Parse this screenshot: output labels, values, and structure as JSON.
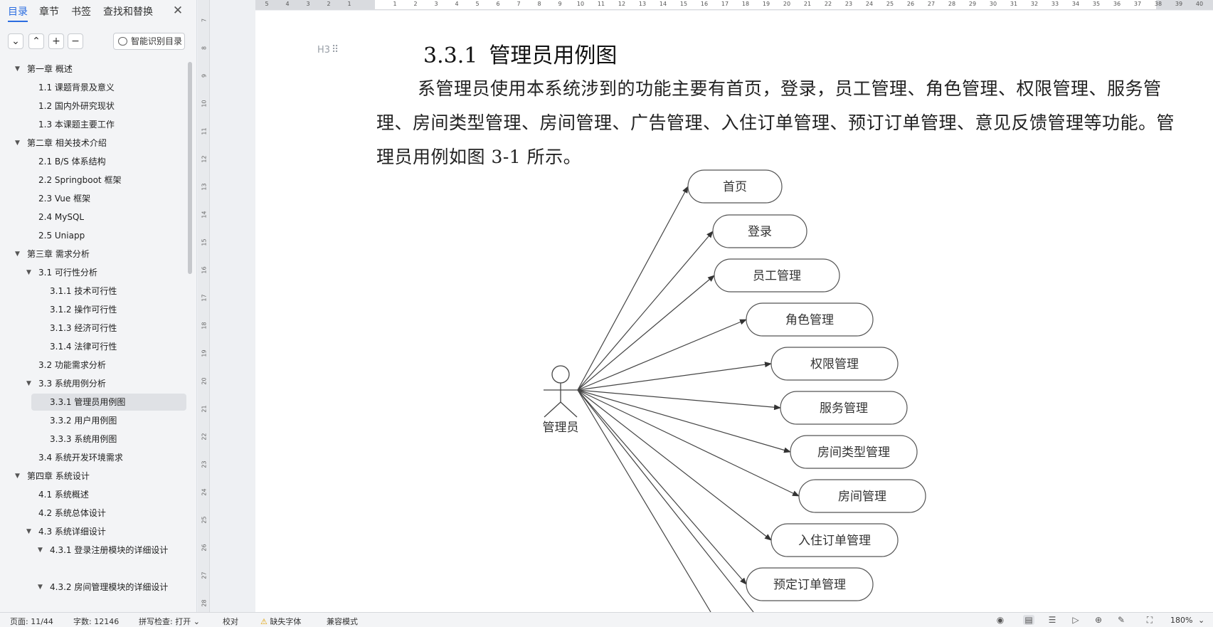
{
  "nav": {
    "tabs": [
      "目录",
      "章节",
      "书签",
      "查找和替换"
    ],
    "close_glyph": "✕",
    "toolbar": {
      "collapse_glyph": "⌄",
      "expand_glyph": "⌃",
      "add_glyph": "+",
      "remove_glyph": "−",
      "smart_toc_label": "智能识别目录"
    },
    "toc": [
      {
        "label": "第一章  概述",
        "level": 1,
        "arrow": "▼"
      },
      {
        "label": "1.1  课题背景及意义",
        "level": 2
      },
      {
        "label": "1.2  国内外研究现状",
        "level": 2
      },
      {
        "label": "1.3  本课题主要工作",
        "level": 2
      },
      {
        "label": "第二章  相关技术介绍",
        "level": 1,
        "arrow": "▼"
      },
      {
        "label": "2.1 B/S 体系结构",
        "level": 2
      },
      {
        "label": "2.2 Springboot 框架",
        "level": 2
      },
      {
        "label": "2.3 Vue 框架",
        "level": 2
      },
      {
        "label": "2.4 MySQL",
        "level": 2
      },
      {
        "label": "2.5 Uniapp",
        "level": 2
      },
      {
        "label": "第三章  需求分析",
        "level": 1,
        "arrow": "▼"
      },
      {
        "label": "3.1  可行性分析",
        "level": 2,
        "arrow": "▼"
      },
      {
        "label": "3.1.1  技术可行性",
        "level": 3
      },
      {
        "label": "3.1.2  操作可行性",
        "level": 3
      },
      {
        "label": "3.1.3  经济可行性",
        "level": 3
      },
      {
        "label": "3.1.4  法律可行性",
        "level": 3
      },
      {
        "label": "3.2  功能需求分析",
        "level": 2
      },
      {
        "label": "3.3  系统用例分析",
        "level": 2,
        "arrow": "▼"
      },
      {
        "label": "3.3.1  管理员用例图",
        "level": 3,
        "selected": true
      },
      {
        "label": "3.3.2  用户用例图",
        "level": 3
      },
      {
        "label": "3.3.3  系统用例图",
        "level": 3
      },
      {
        "label": "3.4 系统开发环境需求",
        "level": 2
      },
      {
        "label": "第四章  系统设计",
        "level": 1,
        "arrow": "▼"
      },
      {
        "label": "4.1  系统概述",
        "level": 2
      },
      {
        "label": "4.2  系统总体设计",
        "level": 2
      },
      {
        "label": "4.3  系统详细设计",
        "level": 2,
        "arrow": "▼"
      },
      {
        "label": "4.3.1  登录注册模块的详细设计",
        "level": 3,
        "arrow": "▼"
      },
      {
        "label": "",
        "level": 3
      },
      {
        "label": "4.3.2  房间管理模块的详细设计",
        "level": 3,
        "arrow": "▼"
      }
    ]
  },
  "ruler": {
    "vertical": [
      "7",
      "8",
      "9",
      "10",
      "11",
      "12",
      "13",
      "14",
      "15",
      "16",
      "17",
      "18",
      "19",
      "20",
      "21",
      "22",
      "23",
      "24",
      "25",
      "26",
      "27",
      "28"
    ],
    "horizontal_left": [
      "5",
      "4",
      "3",
      "2",
      "1"
    ],
    "horizontal_right": [
      "1",
      "2",
      "3",
      "4",
      "5",
      "6",
      "7",
      "8",
      "9",
      "10",
      "11",
      "12",
      "13",
      "14",
      "15",
      "16",
      "17",
      "18",
      "19",
      "20",
      "21",
      "22",
      "23",
      "24",
      "25",
      "26",
      "27",
      "28",
      "29",
      "30",
      "31",
      "32",
      "33",
      "34",
      "35",
      "36",
      "37",
      "38",
      "39",
      "40"
    ]
  },
  "document": {
    "heading_marker": "H3",
    "section_number": "3.3.1",
    "section_title": "管理员用例图",
    "paragraph": "系管理员使用本系统涉到的功能主要有首页，登录，员工管理、角色管理、权限管理、服务管理、房间类型管理、房间管理、广告管理、入住订单管理、预订订单管理、意见反馈管理等功能。管理员用例如图 3-1 所示。",
    "diagram": {
      "actor": "管理员",
      "use_cases": [
        "首页",
        "登录",
        "员工管理",
        "角色管理",
        "权限管理",
        "服务管理",
        "房间类型管理",
        "房间管理",
        "入住订单管理",
        "预定订单管理"
      ]
    }
  },
  "status": {
    "page": "页面: 11/44",
    "words": "字数: 12146",
    "spell": "拼写检查: 打开",
    "proof": "校对",
    "missing_font": "缺失字体",
    "compat": "兼容模式",
    "zoom": "180%"
  }
}
